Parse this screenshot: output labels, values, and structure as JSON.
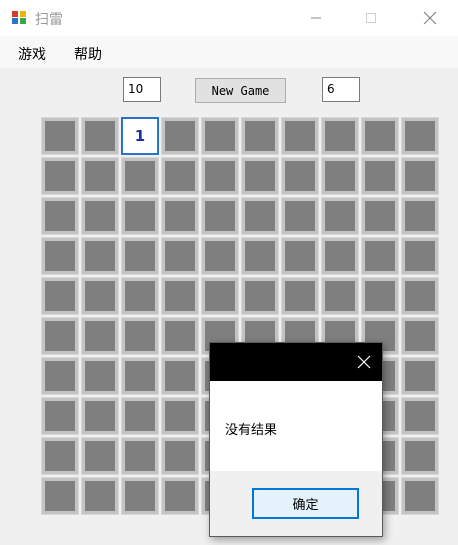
{
  "window": {
    "title": "扫雷",
    "icon": "minesweeper-app-icon",
    "controls": [
      "minimize-icon",
      "maximize-icon",
      "close-icon"
    ]
  },
  "menu": {
    "game_label": "游戏",
    "help_label": "帮助"
  },
  "controls": {
    "mine_count": "10",
    "new_game_label": "New Game",
    "counter_value": "6"
  },
  "board": {
    "rows": 10,
    "cols": 10,
    "revealed": [
      {
        "row": 0,
        "col": 2,
        "value": "1"
      }
    ],
    "colors": {
      "covered": "#7f7f7f",
      "number": "#1f2fa8",
      "focus": "#2a73c8"
    }
  },
  "dialog": {
    "message": "没有结果",
    "ok_label": "确定",
    "close_icon": "close-icon"
  }
}
